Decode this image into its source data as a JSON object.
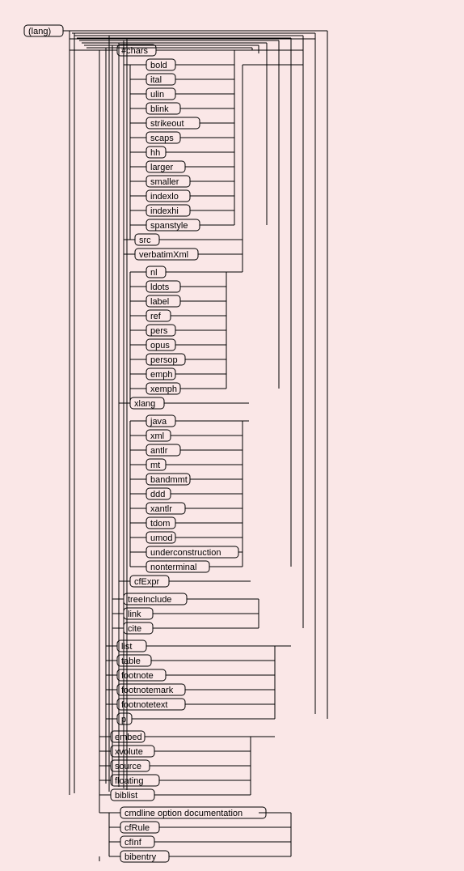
{
  "root": {
    "label": "(lang)"
  },
  "header": {
    "label": "#chars"
  },
  "group_a": [
    {
      "label": "bold"
    },
    {
      "label": "ital"
    },
    {
      "label": "ulin"
    },
    {
      "label": "blink"
    },
    {
      "label": "strikeout"
    },
    {
      "label": "scaps"
    },
    {
      "label": "hh"
    },
    {
      "label": "larger"
    },
    {
      "label": "smaller"
    },
    {
      "label": "indexlo"
    },
    {
      "label": "indexhi"
    },
    {
      "label": "spanstyle"
    }
  ],
  "after_a": [
    {
      "label": "src"
    },
    {
      "label": "verbatimXml"
    }
  ],
  "group_b": [
    {
      "label": "nl"
    },
    {
      "label": "ldots"
    },
    {
      "label": "label"
    },
    {
      "label": "ref"
    },
    {
      "label": "pers"
    },
    {
      "label": "opus"
    },
    {
      "label": "persop"
    },
    {
      "label": "emph"
    },
    {
      "label": "xemph"
    }
  ],
  "after_b": [
    {
      "label": "xlang"
    }
  ],
  "group_c": [
    {
      "label": "java"
    },
    {
      "label": "xml"
    },
    {
      "label": "antlr"
    },
    {
      "label": "mt"
    },
    {
      "label": "bandmmt"
    },
    {
      "label": "ddd"
    },
    {
      "label": "xantlr"
    },
    {
      "label": "tdom"
    },
    {
      "label": "umod"
    },
    {
      "label": "underconstruction"
    },
    {
      "label": "nonterminal"
    }
  ],
  "after_c": [
    {
      "label": "cfExpr"
    }
  ],
  "group_d": [
    {
      "label": "treeInclude"
    },
    {
      "label": "link"
    },
    {
      "label": "cite"
    }
  ],
  "group_e": [
    {
      "label": "list"
    },
    {
      "label": "table"
    },
    {
      "label": "footnote"
    },
    {
      "label": "footnotemark"
    },
    {
      "label": "footnotetext"
    },
    {
      "label": "p"
    }
  ],
  "group_f": [
    {
      "label": "embed"
    },
    {
      "label": "xvolute"
    },
    {
      "label": "source"
    },
    {
      "label": "floating"
    },
    {
      "label": "biblist"
    }
  ],
  "group_g": [
    {
      "label": "cmdline option documentation"
    },
    {
      "label": "cfRule"
    },
    {
      "label": "cfInf"
    },
    {
      "label": "bibentry"
    }
  ],
  "colors": {
    "background": "#fae7e7",
    "stroke": "#000000"
  }
}
